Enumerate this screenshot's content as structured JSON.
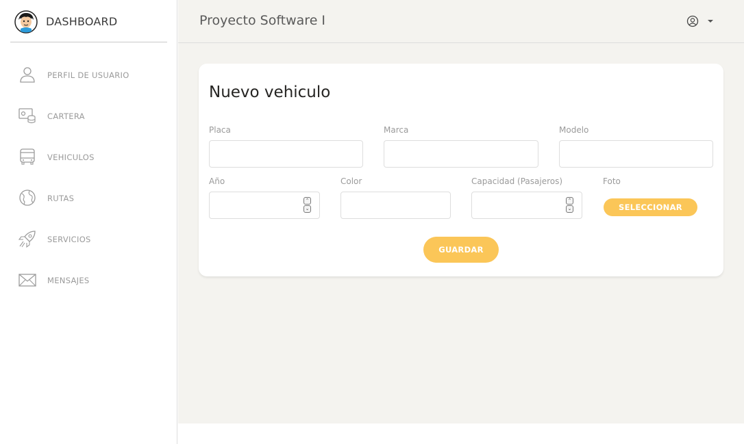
{
  "sidebar": {
    "brand": "DASHBOARD",
    "items": [
      {
        "label": "PERFIL DE USUARIO",
        "icon": "user-icon"
      },
      {
        "label": "CARTERA",
        "icon": "wallet-icon"
      },
      {
        "label": "VEHICULOS",
        "icon": "bus-icon"
      },
      {
        "label": "RUTAS",
        "icon": "globe-icon"
      },
      {
        "label": "SERVICIOS",
        "icon": "rocket-icon"
      },
      {
        "label": "MENSAJES",
        "icon": "envelope-icon"
      }
    ]
  },
  "navbar": {
    "title": "Proyecto Software I",
    "user_icon": "user-circle-icon"
  },
  "form": {
    "title": "Nuevo vehiculo",
    "fields": {
      "placa": {
        "label": "Placa",
        "value": ""
      },
      "marca": {
        "label": "Marca",
        "value": ""
      },
      "modelo": {
        "label": "Modelo",
        "value": ""
      },
      "anio": {
        "label": "Año",
        "value": ""
      },
      "color": {
        "label": "Color",
        "value": ""
      },
      "capacidad": {
        "label": "Capacidad (Pasajeros)",
        "value": ""
      },
      "foto": {
        "label": "Foto"
      }
    },
    "select_button": "SELECCIONAR",
    "save_button": "GUARDAR"
  },
  "colors": {
    "accent": "#fbc658",
    "content_bg": "#f4f3ef",
    "sidebar_bg": "#ffffff"
  }
}
